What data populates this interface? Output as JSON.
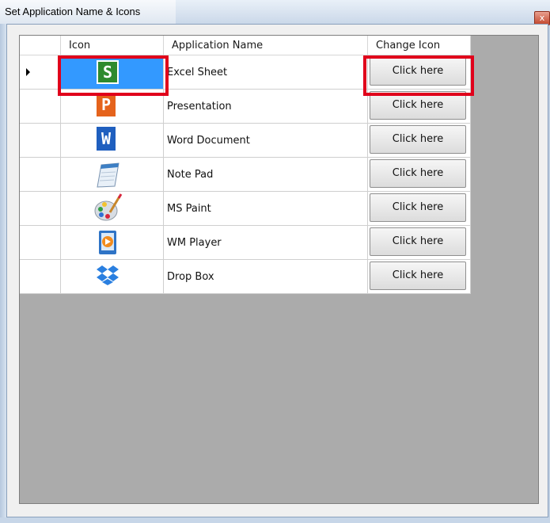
{
  "window": {
    "title": "Set Application Name & Icons",
    "close_glyph": "x"
  },
  "grid": {
    "columns": [
      "Icon",
      "Application Name",
      "Change Icon"
    ],
    "rows": [
      {
        "icon": "spreadsheet-icon",
        "icon_glyph": "S",
        "name": "Excel Sheet",
        "button": "Click here",
        "selected": true
      },
      {
        "icon": "presentation-icon",
        "icon_glyph": "P",
        "name": "Presentation",
        "button": "Click here"
      },
      {
        "icon": "document-icon",
        "icon_glyph": "W",
        "name": "Word Document",
        "button": "Click here"
      },
      {
        "icon": "notepad-icon",
        "name": "Note Pad",
        "button": "Click here"
      },
      {
        "icon": "paint-palette-icon",
        "name": "MS Paint",
        "button": "Click here"
      },
      {
        "icon": "media-player-icon",
        "name": "WM Player",
        "button": "Click here"
      },
      {
        "icon": "dropbox-icon",
        "name": "Drop Box",
        "button": "Click here"
      }
    ]
  },
  "colors": {
    "selected_row": "#3399ff",
    "highlight_box": "#e0001b",
    "grid_background": "#ababab"
  }
}
